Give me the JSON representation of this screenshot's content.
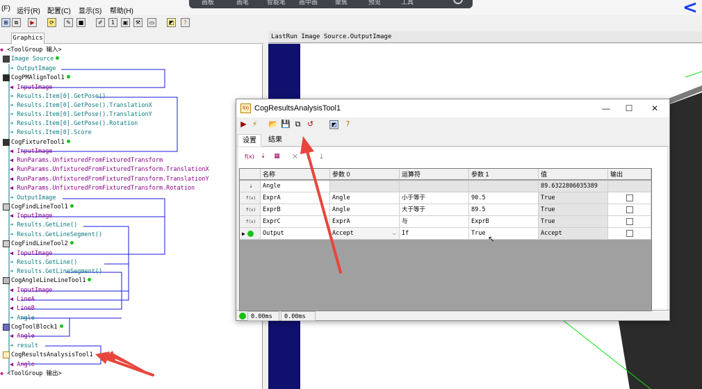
{
  "menu": {
    "items": [
      "(F)",
      "运行(R)",
      "配置(C)",
      "显示(S)",
      "帮助(H)"
    ]
  },
  "floatbar": {
    "items": [
      "画板",
      "画笔",
      "智能笔",
      "画中画",
      "聚焦",
      "预览",
      "工具"
    ]
  },
  "left_tab": "Graphics",
  "tree": {
    "root_in": "<ToolGroup 输入>",
    "image_source": "Image Source",
    "image_source_out": "OutputImage",
    "pmalign": "CogPMAlignTool1",
    "pmalign_in": "InputImage",
    "pmalign_outs": [
      "Results.Item[0].GetPose()",
      "Results.Item[0].GetPose().TranslationX",
      "Results.Item[0].GetPose().TranslationY",
      "Results.Item[0].GetPose().Rotation",
      "Results.Item[0].Score"
    ],
    "fixture": "CogFixtureTool1",
    "fixture_ins": [
      "InputImage",
      "RunParams.UnfixturedFromFixturedTransform",
      "RunParams.UnfixturedFromFixturedTransform.TranslationX",
      "RunParams.UnfixturedFromFixturedTransform.TranslationY",
      "RunParams.UnfixturedFromFixturedTransform.Rotation"
    ],
    "fixture_out": "OutputImage",
    "findline1": "CogFindLineTool1",
    "findline1_in": "InputImage",
    "findline1_outs": [
      "Results.GetLine()",
      "Results.GetLineSegment()"
    ],
    "findline2": "CogFindLineTool2",
    "findline2_in": "InputImage",
    "findline2_outs": [
      "Results.GetLine()",
      "Results.GetLineSegment()"
    ],
    "angleline": "CogAngleLineLineTool1",
    "angleline_ins": [
      "InputImage",
      "LineA",
      "LineB"
    ],
    "angleline_out": "Angle",
    "toolblock": "CogToolBlock1",
    "toolblock_in": "Angle",
    "toolblock_out": "result",
    "results": "CogResultsAnalysisTool1",
    "results_in": "Angle",
    "root_out": "<ToolGroup 输出>"
  },
  "image_pane": {
    "title": "LastRun Image Source.OutputImage"
  },
  "dialog": {
    "title": "CogResultsAnalysisTool1",
    "tabs": [
      "设置",
      "结果"
    ],
    "headers": [
      "名称",
      "参数 0",
      "运算符",
      "参数 1",
      "值",
      "输出"
    ],
    "rows": [
      {
        "name": "Angle",
        "p0": "",
        "op": "",
        "p1": "",
        "value": "89.6322806035389",
        "output": false
      },
      {
        "name": "ExprA",
        "p0": "Angle",
        "op": "小于等于",
        "p1": "90.5",
        "value": "True",
        "output": false
      },
      {
        "name": "ExprB",
        "p0": "Angle",
        "op": "大于等于",
        "p1": "89.5",
        "value": "True",
        "output": false
      },
      {
        "name": "ExprC",
        "p0": "ExprA",
        "op": "与",
        "p1": "ExprB",
        "value": "True",
        "output": false
      },
      {
        "name": "Output",
        "p0": "Accept",
        "op": "If",
        "p1": "True",
        "value": "Accept",
        "output": false
      }
    ],
    "status": [
      "0.00ms",
      "0.00ms"
    ]
  },
  "colors": {
    "link_blue": "#1a1ad8",
    "annotation_red": "#e8453c",
    "ok_green": "#18c018"
  }
}
